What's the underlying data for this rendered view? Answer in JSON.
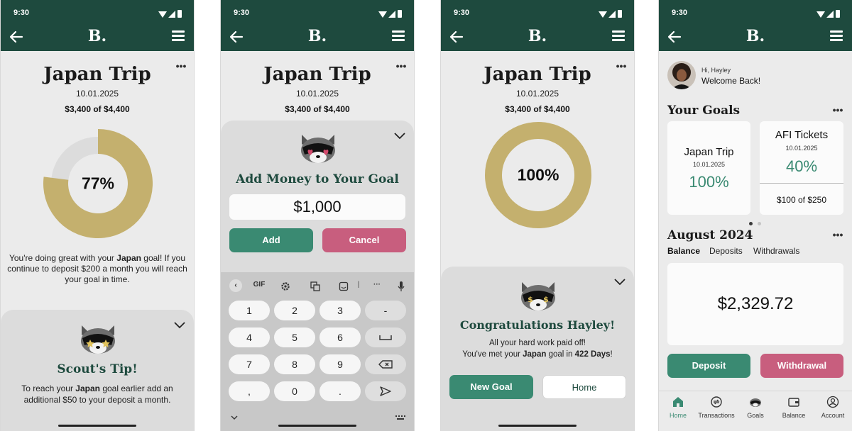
{
  "status": {
    "time": "9:30"
  },
  "app": {
    "brand": "B."
  },
  "goal": {
    "title": "Japan Trip",
    "date": "10.01.2025",
    "amount_text": "$3,400 of $4,400",
    "progress_fraction": 0.77,
    "progress_label": "77%",
    "completed_label": "100%"
  },
  "screen1": {
    "message_1": "You're doing great with your ",
    "message_bold": "Japan",
    "message_2": " goal! If you continue to deposit $200 a month you will reach your goal in time.",
    "tip_title": "Scout's Tip!",
    "tip_1": "To reach your ",
    "tip_bold": "Japan",
    "tip_2": " goal earlier add an additional $50 to your deposit a month."
  },
  "screen2": {
    "sheet_title": "Add Money to Your Goal",
    "amount_value": "$1,000",
    "add_label": "Add",
    "cancel_label": "Cancel",
    "keyboard": {
      "toolbar": [
        "GIF"
      ],
      "keys": [
        "1",
        "2",
        "3",
        "-",
        "4",
        "5",
        "6",
        "7",
        "8",
        "9",
        ",",
        "0",
        "."
      ]
    }
  },
  "screen3": {
    "congrats_title": "Congratulations Hayley!",
    "line_1": "All your hard work paid off!",
    "line_2a": "You've met your ",
    "line_2_bold1": "Japan",
    "line_2b": " goal in ",
    "line_2_bold2": "422 Days",
    "line_2c": "!",
    "new_goal_label": "New Goal",
    "home_label": "Home"
  },
  "screen4": {
    "greeting_small": "Hi, Hayley",
    "greeting_big": "Welcome Back!",
    "goals_title": "Your Goals",
    "goal_cards": [
      {
        "title": "Japan Trip",
        "date": "10.01.2025",
        "percent": "100%"
      },
      {
        "title": "AFI Tickets",
        "date": "10.01.2025",
        "percent": "40%",
        "amount": "$100 of $250"
      }
    ],
    "month_title": "August 2024",
    "tabs": [
      "Balance",
      "Deposits",
      "Withdrawals"
    ],
    "balance": "$2,329.72",
    "deposit_label": "Deposit",
    "withdrawal_label": "Withdrawal",
    "nav": [
      "Home",
      "Transactions",
      "Goals",
      "Balance",
      "Account"
    ]
  },
  "colors": {
    "appbar": "#1e4a3e",
    "accent_green": "#3a8a72",
    "accent_pink": "#c85e7e",
    "donut_gold": "#c4b06e",
    "donut_track": "#dcdcdc"
  }
}
